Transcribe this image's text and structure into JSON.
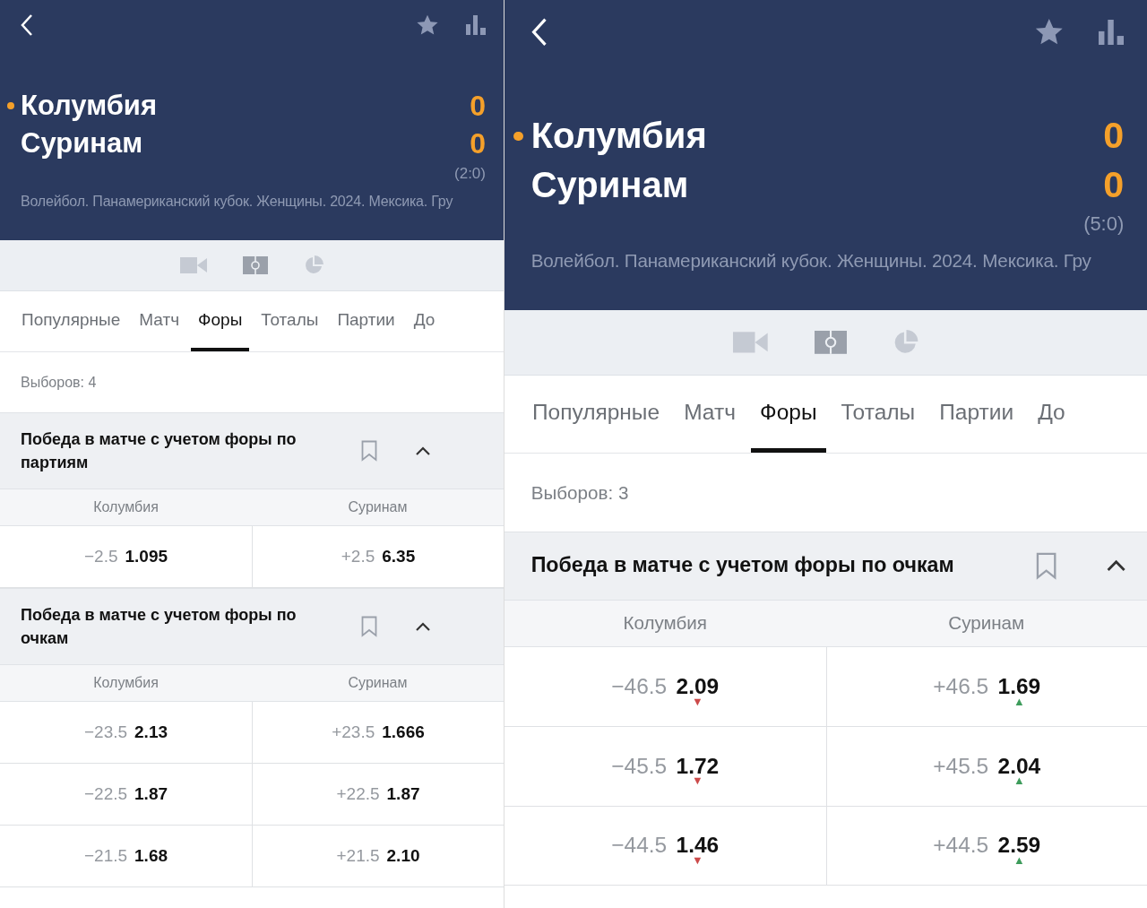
{
  "panels": [
    {
      "teams": [
        {
          "name": "Колумбия",
          "score": "0",
          "serving": true
        },
        {
          "name": "Суринам",
          "score": "0",
          "serving": false
        }
      ],
      "set_score": "(2:0)",
      "league": "Волейбол. Панамериканский кубок. Женщины. 2024. Мексика. Гру",
      "tabs": [
        {
          "label": "Популярные",
          "selected": false
        },
        {
          "label": "Матч",
          "selected": false
        },
        {
          "label": "Форы",
          "selected": true
        },
        {
          "label": "Тоталы",
          "selected": false
        },
        {
          "label": "Партии",
          "selected": false
        },
        {
          "label": "До",
          "selected": false
        }
      ],
      "count": "Выборов: 4",
      "markets": [
        {
          "title": "Победа в матче с учетом форы по партиям",
          "expanded": true,
          "columns": [
            "Колумбия",
            "Суринам"
          ],
          "rows": [
            [
              {
                "handicap": "−2.5",
                "odd": "1.095"
              },
              {
                "handicap": "+2.5",
                "odd": "6.35"
              }
            ]
          ]
        },
        {
          "title": "Победа в матче с учетом форы по очкам",
          "expanded": true,
          "columns": [
            "Колумбия",
            "Суринам"
          ],
          "rows": [
            [
              {
                "handicap": "−23.5",
                "odd": "2.13"
              },
              {
                "handicap": "+23.5",
                "odd": "1.666"
              }
            ],
            [
              {
                "handicap": "−22.5",
                "odd": "1.87"
              },
              {
                "handicap": "+22.5",
                "odd": "1.87"
              }
            ],
            [
              {
                "handicap": "−21.5",
                "odd": "1.68"
              },
              {
                "handicap": "+21.5",
                "odd": "2.10"
              }
            ]
          ]
        }
      ]
    },
    {
      "teams": [
        {
          "name": "Колумбия",
          "score": "0",
          "serving": true
        },
        {
          "name": "Суринам",
          "score": "0",
          "serving": false
        }
      ],
      "set_score": "(5:0)",
      "league": "Волейбол. Панамериканский кубок. Женщины. 2024. Мексика. Гру",
      "tabs": [
        {
          "label": "Популярные",
          "selected": false
        },
        {
          "label": "Матч",
          "selected": false
        },
        {
          "label": "Форы",
          "selected": true
        },
        {
          "label": "Тоталы",
          "selected": false
        },
        {
          "label": "Партии",
          "selected": false
        },
        {
          "label": "До",
          "selected": false
        }
      ],
      "count": "Выборов: 3",
      "markets": [
        {
          "title": "Победа в матче с учетом форы по очкам",
          "expanded": true,
          "columns": [
            "Колумбия",
            "Суринам"
          ],
          "rows": [
            [
              {
                "handicap": "−46.5",
                "odd": "2.09",
                "trend": "▼",
                "color": "#cc4a4a"
              },
              {
                "handicap": "+46.5",
                "odd": "1.69",
                "trend": "▲",
                "color": "#3e9c5c"
              }
            ],
            [
              {
                "handicap": "−45.5",
                "odd": "1.72",
                "trend": "▼",
                "color": "#cc4a4a"
              },
              {
                "handicap": "+45.5",
                "odd": "2.04",
                "trend": "▲",
                "color": "#3e9c5c"
              }
            ],
            [
              {
                "handicap": "−44.5",
                "odd": "1.46",
                "trend": "▼",
                "color": "#cc4a4a"
              },
              {
                "handicap": "+44.5",
                "odd": "2.59",
                "trend": "▲",
                "color": "#3e9c5c"
              }
            ]
          ]
        }
      ]
    }
  ]
}
